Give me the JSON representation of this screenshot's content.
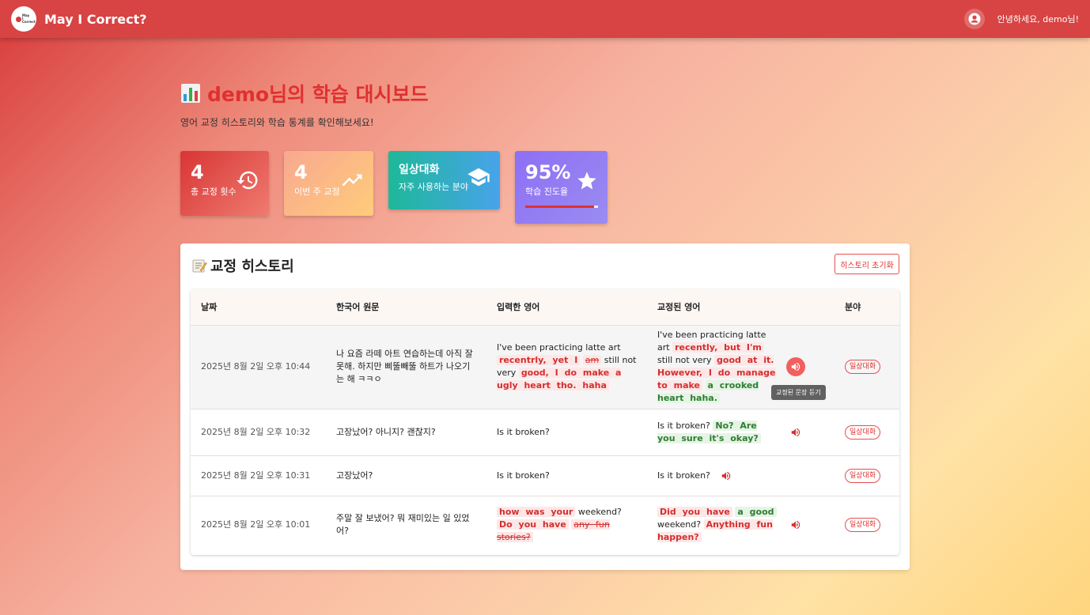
{
  "appbar": {
    "title": "May I Correct?",
    "logo_text": "May I Correct",
    "greeting": "안녕하세요, demo님!"
  },
  "header": {
    "title": "demo님의 학습 대시보드",
    "subtitle": "영어 교정 히스토리와 학습 통계를 확인해보세요!"
  },
  "stats": [
    {
      "value": "4",
      "label": "총 교정 횟수",
      "icon": "history-icon"
    },
    {
      "value": "4",
      "label": "이번 주 교정",
      "icon": "trending-up-icon"
    },
    {
      "value": "일상대화",
      "label": "자주 사용하는 분야",
      "icon": "graduation-cap-icon"
    },
    {
      "value": "95%",
      "label": "학습 진도율",
      "icon": "star-icon",
      "progress": 0.95
    }
  ],
  "history": {
    "title": "교정 히스토리",
    "reset_label": "히스토리 초기화",
    "columns": [
      "날짜",
      "한국어 원문",
      "입력한 영어",
      "교정된 영어",
      "분야"
    ],
    "tooltip": "교정된 문장 듣기",
    "rows": [
      {
        "date": "2025년 8월 2일 오후 10:44",
        "korean": "나 요즘 라떼 아트 연습하는데 아직 잘 못해. 하지만 삐뚤빼뚤 하트가 나오기는 해 ㅋㅋㅇ",
        "input_a": "I've been practicing latte art",
        "input_b": "recentrly, yet I",
        "input_c": "am",
        "input_d": "still not very",
        "input_e": "good, I do make a ugly heart tho. haha",
        "corr_a": "I've been practicing latte art",
        "corr_b": "recently, but I'm",
        "corr_c": "still not very",
        "corr_d": "good at it. However, I do manage to make",
        "corr_e": "a crooked heart haha.",
        "category": "일상대화"
      },
      {
        "date": "2025년 8월 2일 오후 10:32",
        "korean": "고장났어? 아니지? 괜찮지?",
        "input_a": "Is it broken?",
        "corr_a": "Is it broken?",
        "corr_b": "No? Are you sure it's okay?",
        "category": "일상대화"
      },
      {
        "date": "2025년 8월 2일 오후 10:31",
        "korean": "고장났어?",
        "input_a": "Is it broken?",
        "corr_a": "Is it broken?",
        "category": "일상대화"
      },
      {
        "date": "2025년 8월 2일 오후 10:01",
        "korean": "주말 잘 보냈어? 뭐 재미있는 일 있었어?",
        "input_a": "how was your",
        "input_b": "weekend?",
        "input_c": "Do you have",
        "input_d": "any fun stories?",
        "corr_a": "Did you have",
        "corr_b": "a good",
        "corr_c": "weekend?",
        "corr_d": "Anything fun happen?",
        "category": "일상대화"
      }
    ]
  },
  "colors": {
    "brand": "#d84343",
    "accent_red": "#e03030",
    "added_green": "#2e7d32"
  }
}
